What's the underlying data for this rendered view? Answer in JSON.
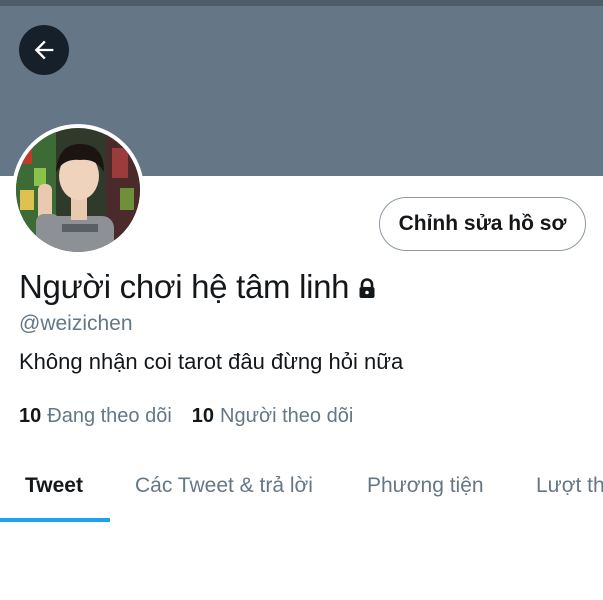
{
  "profile": {
    "display_name": "Người chơi hệ tâm linh",
    "handle": "@weizichen",
    "bio": "Không nhận coi tarot đâu đừng hỏi nữa",
    "protected_icon": "lock-icon"
  },
  "actions": {
    "back_icon": "arrow-left-icon",
    "edit_profile_label": "Chỉnh sửa hồ sơ"
  },
  "stats": {
    "following_count": "10",
    "following_label": "Đang theo dõi",
    "followers_count": "10",
    "followers_label": "Người theo dõi"
  },
  "tabs": [
    {
      "label": "Tweet",
      "active": true
    },
    {
      "label": "Các Tweet & trả lời",
      "active": false
    },
    {
      "label": "Phương tiện",
      "active": false
    },
    {
      "label": "Lượt thích",
      "active": false
    }
  ],
  "colors": {
    "banner": "#657786",
    "accent": "#1da1f2",
    "text_primary": "#14171a",
    "text_secondary": "#657786"
  }
}
